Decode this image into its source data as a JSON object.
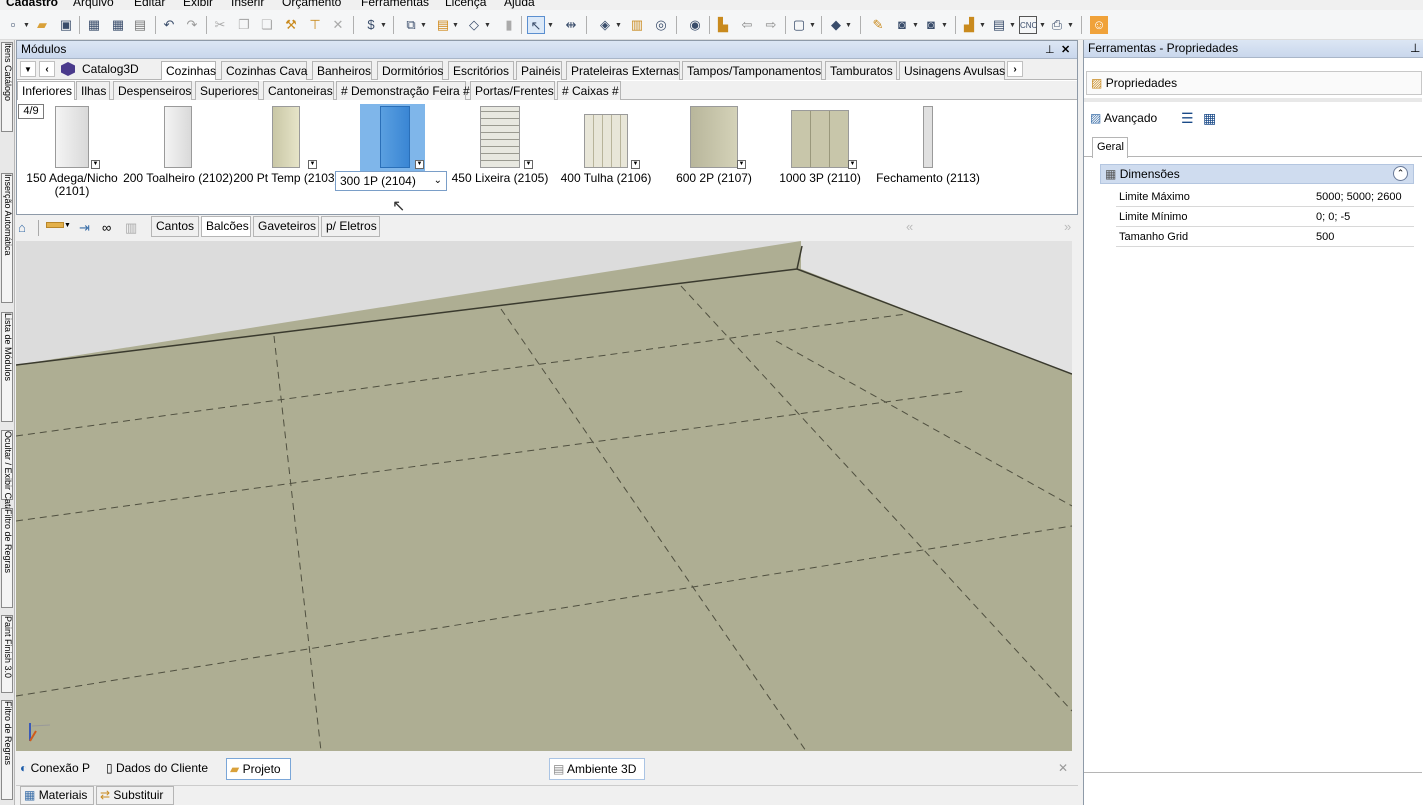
{
  "menu": [
    "Cadastro",
    "Arquivo",
    "Editar",
    "Exibir",
    "Inserir",
    "Orçamento",
    "Ferramentas",
    "Licença",
    "Ajuda"
  ],
  "left_strip_tabs": [
    "Itens Catálogo",
    "Inserção Automática",
    "Lista de Módulos",
    "Ocultar / Exibir Catálogo",
    "Filtro de Regras",
    "Paint Finish 3.0",
    "Filtro de Regras"
  ],
  "modules_panel": {
    "title": "Módulos",
    "catalog": "Catalog3D",
    "tabs_row1": [
      "Cozinhas",
      "Cozinhas Cava",
      "Banheiros",
      "Dormitórios",
      "Escritórios",
      "Painéis",
      "Prateleiras Externas",
      "Tampos/Tamponamentos",
      "Tamburatos",
      "Usinagens Avulsas"
    ],
    "tabs_row2": [
      "Inferiores",
      "Ilhas",
      "Despenseiros",
      "Superiores",
      "Cantoneiras",
      "# Demonstração Feira #",
      "Portas/Frentes",
      "# Caixas #"
    ],
    "page_indicator": "4/9",
    "items": [
      {
        "label": "150 Adega/Nicho (2101)"
      },
      {
        "label": "200 Toalheiro (2102)"
      },
      {
        "label": "200 Pt Temp (2103)"
      },
      {
        "label": "300 1P (2104)",
        "selected": true
      },
      {
        "label": "450 Lixeira (2105)"
      },
      {
        "label": "400 Tulha (2106)"
      },
      {
        "label": "600 2P (2107)"
      },
      {
        "label": "1000 3P (2110)"
      },
      {
        "label": "Fechamento (2113)"
      }
    ]
  },
  "view_tabs": [
    "Cantos",
    "Balcões",
    "Gaveteiros",
    "p/ Eletros"
  ],
  "bottom_tabs": [
    "Conexão P",
    "Dados do Cliente",
    "Projeto",
    "Ambiente 3D"
  ],
  "bottom_bar": [
    "Materiais",
    "Substituir"
  ],
  "right_panel": {
    "title": "Ferramentas - Propriedades",
    "properties_tab": "Propriedades",
    "advanced_label": "Avançado",
    "geral_tab": "Geral",
    "section": "Dimensões",
    "rows": [
      {
        "name": "Limite Máximo",
        "value": "5000; 5000; 2600"
      },
      {
        "name": "Limite Mínimo",
        "value": "0; 0; -5"
      },
      {
        "name": "Tamanho Grid",
        "value": "500"
      }
    ]
  },
  "colors": {
    "floor": "#aeae93",
    "wall": "#dcdcdc",
    "selection": "#7fb6ea",
    "panel_header": "#cfdcef"
  }
}
